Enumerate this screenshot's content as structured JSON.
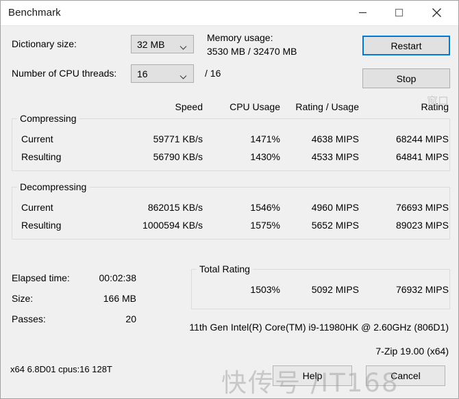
{
  "window": {
    "title": "Benchmark",
    "controls": {
      "minimize": "minimize-icon",
      "maximize": "maximize-icon",
      "close": "close-icon"
    }
  },
  "settings": {
    "dictionary_label": "Dictionary size:",
    "dictionary_value": "32 MB",
    "threads_label": "Number of CPU threads:",
    "threads_value": "16",
    "threads_max": "/ 16",
    "memory_label": "Memory usage:",
    "memory_value": "3530 MB / 32470 MB"
  },
  "actions": {
    "restart": "Restart",
    "stop": "Stop",
    "help": "Help",
    "cancel": "Cancel"
  },
  "columns": {
    "speed": "Speed",
    "cpu_usage": "CPU Usage",
    "rating_usage": "Rating / Usage",
    "rating": "Rating"
  },
  "compressing": {
    "title": "Compressing",
    "rows": [
      {
        "label": "Current",
        "speed": "59771 KB/s",
        "cpu": "1471%",
        "rating_usage": "4638 MIPS",
        "rating": "68244 MIPS"
      },
      {
        "label": "Resulting",
        "speed": "56790 KB/s",
        "cpu": "1430%",
        "rating_usage": "4533 MIPS",
        "rating": "64841 MIPS"
      }
    ]
  },
  "decompressing": {
    "title": "Decompressing",
    "rows": [
      {
        "label": "Current",
        "speed": "862015 KB/s",
        "cpu": "1546%",
        "rating_usage": "4960 MIPS",
        "rating": "76693 MIPS"
      },
      {
        "label": "Resulting",
        "speed": "1000594 KB/s",
        "cpu": "1575%",
        "rating_usage": "5652 MIPS",
        "rating": "89023 MIPS"
      }
    ]
  },
  "stats": {
    "elapsed_label": "Elapsed time:",
    "elapsed_value": "00:02:38",
    "size_label": "Size:",
    "size_value": "166 MB",
    "passes_label": "Passes:",
    "passes_value": "20"
  },
  "total_rating": {
    "title": "Total Rating",
    "cpu": "1503%",
    "rating_usage": "5092 MIPS",
    "rating": "76932 MIPS"
  },
  "info": {
    "cpu_name": "11th Gen Intel(R) Core(TM) i9-11980HK @ 2.60GHz (806D1)",
    "version": "7-Zip 19.00 (x64)"
  },
  "statusbar": {
    "text": "x64 6.8D01 cpus:16 128T"
  },
  "overlay": {
    "watermark": "快传号 /IT168",
    "watermark_small": "窗口"
  },
  "colors": {
    "accent": "#0078d7",
    "window_bg": "#f0f0f0",
    "control_bg": "#e1e1e1",
    "border": "#adadad"
  }
}
